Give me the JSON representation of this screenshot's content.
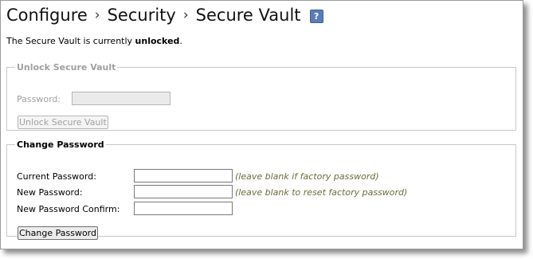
{
  "breadcrumb": {
    "items": [
      "Configure",
      "Security",
      "Secure Vault"
    ],
    "separator": "›"
  },
  "help_icon_glyph": "?",
  "status": {
    "prefix": "The Secure Vault is currently ",
    "state": "unlocked",
    "suffix": "."
  },
  "unlock_section": {
    "legend": "Unlock Secure Vault",
    "password_label": "Password:",
    "password_value": "",
    "button_label": "Unlock Secure Vault"
  },
  "change_section": {
    "legend": "Change Password",
    "current_label": "Current Password:",
    "current_value": "",
    "current_hint": "(leave blank if factory password)",
    "new_label": "New Password:",
    "new_value": "",
    "new_hint": "(leave blank to reset factory password)",
    "confirm_label": "New Password Confirm:",
    "confirm_value": "",
    "button_label": "Change Password"
  },
  "colors": {
    "help_icon_bg": "#5b7db5",
    "hint_text": "#6b6b3a",
    "disabled_text": "#a0a0a0"
  }
}
